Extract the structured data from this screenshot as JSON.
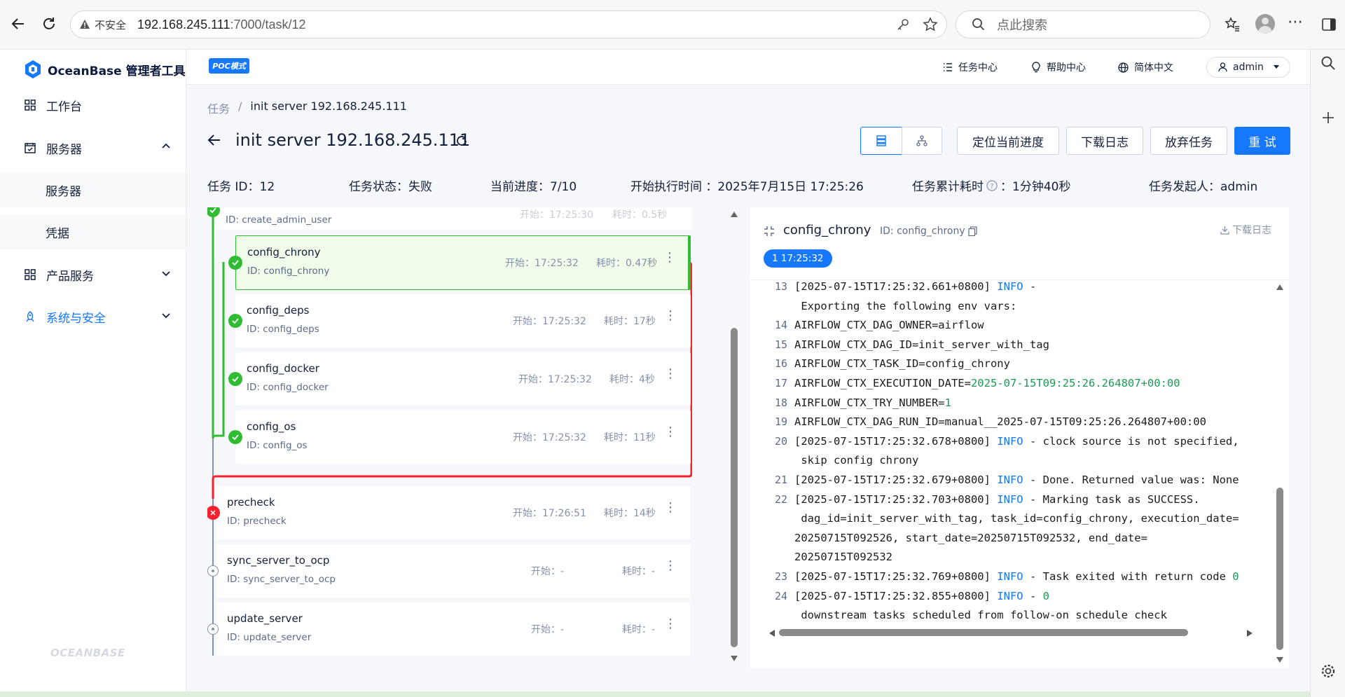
{
  "browser": {
    "security_label": "不安全",
    "url_host": "192.168.245.111",
    "url_path": ":7000/task/12",
    "search_placeholder": "点此搜索"
  },
  "app": {
    "logo_text": "OceanBase 管理者工具",
    "poc_badge": "POC模式",
    "footer_logo": "OCEANBASE"
  },
  "sidebar": {
    "items": [
      {
        "label": "工作台",
        "icon": "dashboard-icon"
      },
      {
        "label": "服务器",
        "icon": "server-icon"
      },
      {
        "label": "服务器"
      },
      {
        "label": "凭据"
      },
      {
        "label": "产品服务",
        "icon": "product-icon"
      },
      {
        "label": "系统与安全",
        "icon": "security-icon"
      }
    ],
    "active_color": "#1677ff"
  },
  "header": {
    "task_center": "任务中心",
    "help_center": "帮助中心",
    "language": "简体中文",
    "user": "admin"
  },
  "breadcrumb": {
    "parent": "任务",
    "separator": "/",
    "current": "init server 192.168.245.111"
  },
  "page": {
    "title": "init server 192.168.245.111",
    "buttons": {
      "locate": "定位当前进度",
      "download": "下载日志",
      "abandon": "放弃任务",
      "retry": "重 试"
    },
    "info": {
      "task_id": "任务 ID：12",
      "status": "任务状态：失败",
      "progress": "当前进度：7/10",
      "start_time": "开始执行时间 ：2025年7月15日 17:25:26",
      "duration_label": "任务累计耗时",
      "duration_value": "：1分钟40秒",
      "initiator": "任务发起人：admin"
    }
  },
  "nodes": [
    {
      "name": "",
      "id": "ID: create_admin_user",
      "start": "开始：17:25:30",
      "cost": "耗时：0.5秒"
    },
    {
      "name": "config_chrony",
      "id": "ID: config_chrony",
      "start": "开始：17:25:32",
      "cost": "耗时：0.47秒"
    },
    {
      "name": "config_deps",
      "id": "ID: config_deps",
      "start": "开始：17:25:32",
      "cost": "耗时：17秒"
    },
    {
      "name": "config_docker",
      "id": "ID: config_docker",
      "start": "开始：17:25:32",
      "cost": "耗时：4秒"
    },
    {
      "name": "config_os",
      "id": "ID: config_os",
      "start": "开始：17:25:32",
      "cost": "耗时：11秒"
    },
    {
      "name": "precheck",
      "id": "ID: precheck",
      "start": "开始：17:26:51",
      "cost": "耗时：14秒"
    },
    {
      "name": "sync_server_to_ocp",
      "id": "ID: sync_server_to_ocp",
      "start": "开始：-",
      "cost": "耗时：-"
    },
    {
      "name": "update_server",
      "id": "ID: update_server",
      "start": "开始：-",
      "cost": "耗时：-"
    }
  ],
  "colors": {
    "success": "#2fbc33",
    "fail": "#f5222d",
    "primary": "#1677ff"
  },
  "log": {
    "title": "config_chrony",
    "id_label": "ID: config_chrony",
    "download": "下载日志",
    "run_tag": "1 17:25:32",
    "lines": [
      {
        "n": "13",
        "a": "[2025-07-15T17:25:32.661+0800] ",
        "lvl": "INFO",
        "b": " -"
      },
      {
        "n": "",
        "a": " Exporting the following env vars:"
      },
      {
        "n": "14",
        "a": "AIRFLOW_CTX_DAG_OWNER=airflow"
      },
      {
        "n": "15",
        "a": "AIRFLOW_CTX_DAG_ID=init_server_with_tag"
      },
      {
        "n": "16",
        "a": "AIRFLOW_CTX_TASK_ID=config_chrony"
      },
      {
        "n": "17",
        "a": "AIRFLOW_CTX_EXECUTION_DATE=",
        "g": "2025-07-15T09:25:26.264807+00:00"
      },
      {
        "n": "18",
        "a": "AIRFLOW_CTX_TRY_NUMBER=",
        "g": "1"
      },
      {
        "n": "19",
        "a": "AIRFLOW_CTX_DAG_RUN_ID=manual__2025-07-15T09:25:26.264807+00:00"
      },
      {
        "n": "20",
        "a": "[2025-07-15T17:25:32.678+0800] ",
        "lvl": "INFO",
        "b": " - clock source is not specified,"
      },
      {
        "n": "",
        "a": " skip config chrony"
      },
      {
        "n": "21",
        "a": "[2025-07-15T17:25:32.679+0800] ",
        "lvl": "INFO",
        "b": " - Done. Returned value was: None"
      },
      {
        "n": "22",
        "a": "[2025-07-15T17:25:32.703+0800] ",
        "lvl": "INFO",
        "b": " - Marking task as SUCCESS."
      },
      {
        "n": "",
        "a": " dag_id=init_server_with_tag, task_id=config_chrony, execution_date="
      },
      {
        "n": "",
        "a": "20250715T092526, start_date=20250715T092532, end_date="
      },
      {
        "n": "",
        "a": "20250715T092532"
      },
      {
        "n": "23",
        "a": "[2025-07-15T17:25:32.769+0800] ",
        "lvl": "INFO",
        "b": " - Task exited with return code ",
        "g": "0"
      },
      {
        "n": "24",
        "a": "[2025-07-15T17:25:32.855+0800] ",
        "lvl": "INFO",
        "b": " - ",
        "g": "0"
      },
      {
        "n": "",
        "a": " downstream tasks scheduled from follow-on schedule check"
      }
    ]
  }
}
